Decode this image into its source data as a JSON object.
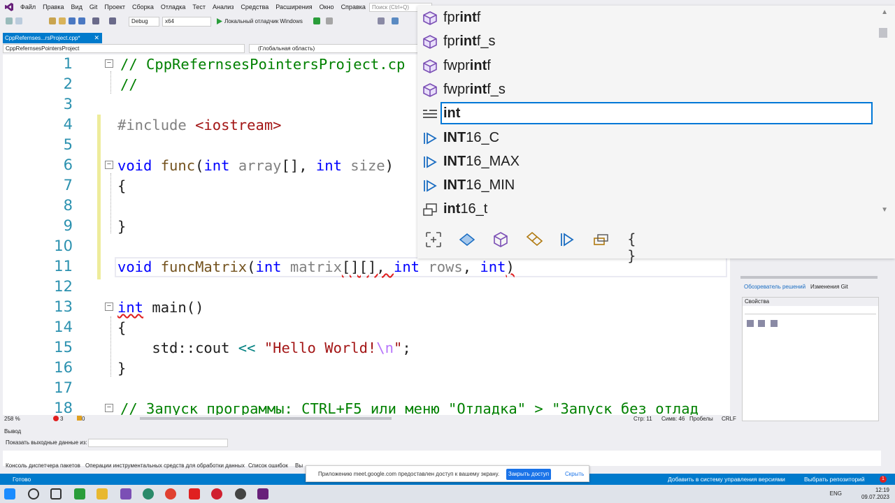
{
  "menu": {
    "items": [
      "Файл",
      "Правка",
      "Вид",
      "Git",
      "Проект",
      "Сборка",
      "Отладка",
      "Тест",
      "Анализ",
      "Средства",
      "Расширения",
      "Окно",
      "Справка"
    ],
    "search_placeholder": "Поиск (Ctrl+Q)"
  },
  "toolbar": {
    "config": "Debug",
    "platform": "x64",
    "run_label": "Локальный отладчик Windows"
  },
  "editor": {
    "tab_title": "CppRefernses...rsProject.cpp*",
    "tab_close": "✕",
    "nav_project": "CppRefernsesPointersProject",
    "nav_scope": "(Глобальная область)",
    "zoom": "258 %",
    "errors": "3",
    "warnings": "0",
    "line_col": "Стр: 11",
    "chars": "Симв: 46",
    "spaces": "Пробелы",
    "eol": "CRLF"
  },
  "code_lines": [
    {
      "n": "1",
      "text": "// CppRefernsesPointersProject.cp"
    },
    {
      "n": "2",
      "text": "//"
    },
    {
      "n": "3",
      "text": ""
    },
    {
      "n": "4",
      "text": "#include <iostream>"
    },
    {
      "n": "5",
      "text": ""
    },
    {
      "n": "6",
      "text": "void func(int array[], int size)"
    },
    {
      "n": "7",
      "text": "{"
    },
    {
      "n": "8",
      "text": ""
    },
    {
      "n": "9",
      "text": "}"
    },
    {
      "n": "10",
      "text": ""
    },
    {
      "n": "11",
      "text": "void funcMatrix(int matrix[][], int rows, int)"
    },
    {
      "n": "12",
      "text": ""
    },
    {
      "n": "13",
      "text": "int main()"
    },
    {
      "n": "14",
      "text": "{"
    },
    {
      "n": "15",
      "text": "    std::cout << \"Hello World!\\n\";"
    },
    {
      "n": "16",
      "text": "}"
    },
    {
      "n": "17",
      "text": ""
    },
    {
      "n": "18",
      "text": "// Запуск программы: CTRL+F5 или меню \"Отладка\" > \"Запуск без отлад"
    }
  ],
  "code_tokens": {
    "l1": "// CppRefernsesPointersProject.cp",
    "l2": "//",
    "l4a": "#include ",
    "l4b": "<iostream>",
    "l6_void": "void",
    "l6_func": "func",
    "l6_open": "(",
    "l6_int1": "int",
    "l6_array": "array",
    "l6_br": "[], ",
    "l6_int2": "int",
    "l6_size": "size",
    "l6_close": ")",
    "brace_open": "{",
    "brace_close": "}",
    "l11_void": "void",
    "l11_func": "funcMatrix",
    "l11_open": "(",
    "l11_int1": "int",
    "l11_matrix": "matrix",
    "l11_br": "[][], ",
    "l11_int2": "int",
    "l11_rows": "rows",
    "l11_comma": ", ",
    "l11_int3": "int",
    "l11_close": ")",
    "l13_int": "int",
    "l13_main": " main()",
    "l15_std": "    std::cout ",
    "l15_op": "<<",
    "l15_sp": " ",
    "l15_str1": "\"Hello World!",
    "l15_esc": "\\n",
    "l15_str2": "\"",
    "l15_semi": ";",
    "l18": "// Запуск программы: CTRL+F5 или меню \"Отладка\" > \"Запуск без отлад"
  },
  "intellisense": {
    "suggestions": [
      {
        "pre": "fpr",
        "bold": "int",
        "post": "f",
        "icon": "cube-icon"
      },
      {
        "pre": "fpr",
        "bold": "int",
        "post": "f_s",
        "icon": "cube-icon"
      },
      {
        "pre": "fwpr",
        "bold": "int",
        "post": "f",
        "icon": "cube-icon"
      },
      {
        "pre": "fwpr",
        "bold": "int",
        "post": "f_s",
        "icon": "cube-icon"
      },
      {
        "pre": "",
        "bold": "int",
        "post": "",
        "icon": "keyword-icon"
      },
      {
        "pre": "",
        "bold": "INT",
        "post": "16_C",
        "icon": "macro-icon"
      },
      {
        "pre": "",
        "bold": "INT",
        "post": "16_MAX",
        "icon": "macro-icon"
      },
      {
        "pre": "",
        "bold": "INT",
        "post": "16_MIN",
        "icon": "macro-icon"
      },
      {
        "pre": "",
        "bold": "int",
        "post": "16_t",
        "icon": "typedef-icon"
      }
    ],
    "selected_index": 4,
    "filters": [
      "{ }"
    ]
  },
  "right_panel": {
    "tab_solution": "Обозреватель решений",
    "tab_git": "Изменения Git",
    "props_title": "Свойства"
  },
  "output": {
    "title": "Вывод",
    "label": "Показать выходные данные из:"
  },
  "bottom_tabs": [
    "Консоль диспетчера пакетов",
    "Операции инструментальных средств для обработки данных",
    "Список ошибок",
    "Вы"
  ],
  "statusbar": {
    "ready": "Готово",
    "add_vcs": "Добавить в систему управления версиями",
    "choose_repo": "Выбрать репозиторий",
    "badge": "1"
  },
  "notification": {
    "text": "Приложению meet.google.com предоставлен доступ к вашему экрану.",
    "stop": "Закрыть доступ",
    "hide": "Скрыть"
  },
  "taskbar": {
    "lang": "ENG",
    "time": "12:19",
    "date": "09.07.2023"
  },
  "colors": {
    "accent": "#007acc",
    "keyword": "#0000ff",
    "comment": "#008000",
    "string": "#a31515",
    "linenum": "#2b91af"
  }
}
